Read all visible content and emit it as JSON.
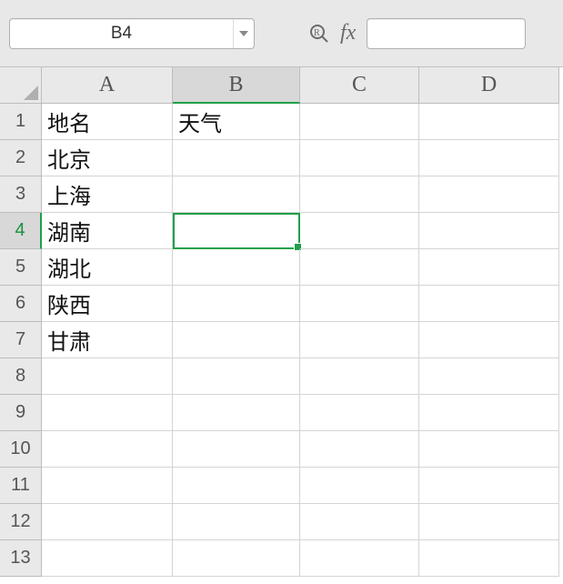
{
  "namebox": {
    "value": "B4"
  },
  "formula_bar": {
    "value": ""
  },
  "columns": [
    "A",
    "B",
    "C",
    "D"
  ],
  "row_count": 13,
  "active": {
    "col": "B",
    "row": 4
  },
  "cells": {
    "A1": "地名",
    "B1": "天气",
    "A2": "北京",
    "A3": "上海",
    "A4": "湖南",
    "A5": "湖北",
    "A6": "陕西",
    "A7": "甘肃"
  },
  "chart_data": {
    "type": "table",
    "title": "",
    "columns": [
      "地名",
      "天气"
    ],
    "rows": [
      [
        "北京",
        ""
      ],
      [
        "上海",
        ""
      ],
      [
        "湖南",
        ""
      ],
      [
        "湖北",
        ""
      ],
      [
        "陕西",
        ""
      ],
      [
        "甘肃",
        ""
      ]
    ]
  }
}
